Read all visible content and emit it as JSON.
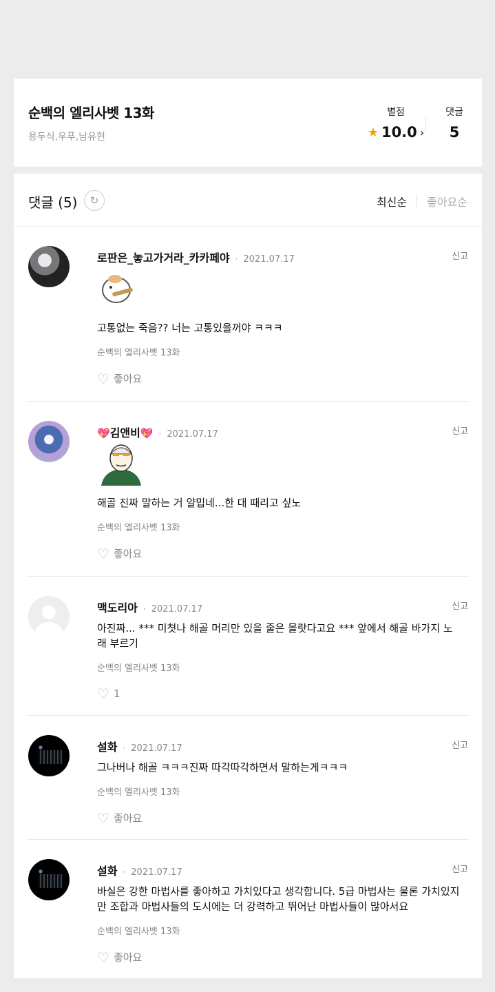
{
  "episode": {
    "title": "순백의 엘리사벳 13화",
    "authors": "용두식,우푸,남유현"
  },
  "stats": {
    "rating_label": "별점",
    "rating_value": "10.0",
    "rating_icon": "star-icon",
    "comments_label": "댓글",
    "comments_value": "5"
  },
  "comments_section": {
    "title": "댓글 (5)",
    "sort_latest": "최신순",
    "sort_likes": "좋아요순"
  },
  "comments": [
    {
      "name": "로판은_놓고가거라_카카페야",
      "date": "2021.07.17",
      "report": "신고",
      "text": "고통없는 죽음?? 너는 고통있을꺼야 ㅋㅋㅋ",
      "source": "순백의 엘리사벳 13화",
      "like": "좋아요"
    },
    {
      "name": "김앤비",
      "date": "2021.07.17",
      "report": "신고",
      "text": "해골 진짜 말하는 거 얄밉네...한 대 때리고 싶노",
      "source": "순백의 엘리사벳 13화",
      "like": "좋아요"
    },
    {
      "name": "맥도리아",
      "date": "2021.07.17",
      "report": "신고",
      "text": "아진짜... *** 미쳣나 해골 머리만 있을 줄은 몰랏다고요 *** 앞에서 해골 바가지 노래 부르기",
      "source": "순백의 엘리사벳 13화",
      "like": "1"
    },
    {
      "name": "설화",
      "date": "2021.07.17",
      "report": "신고",
      "text": "그나버나 해골 ㅋㅋㅋ진짜 따각따각하면서 말하는게ㅋㅋㅋ",
      "source": "순백의 엘리사벳 13화",
      "like": "좋아요"
    },
    {
      "name": "설화",
      "date": "2021.07.17",
      "report": "신고",
      "text": "바실은 강한 마법사를 좋아하고 가치있다고 생각합니다. 5급 마법사는 물론 가치있지만 조합과 마법사들의 도시에는 더 강력하고 뛰어난 마법사들이 많아서요",
      "source": "순백의 엘리사벳 13화",
      "like": "좋아요"
    }
  ]
}
